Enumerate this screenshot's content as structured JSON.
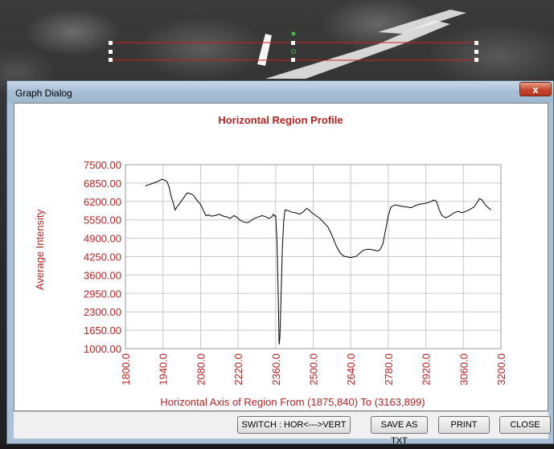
{
  "dialog": {
    "title": "Graph Dialog",
    "close_glyph": "x",
    "buttons": {
      "switch": "SWITCH : HOR<--->VERT",
      "save": "SAVE AS TXT",
      "print": "PRINT",
      "close": "CLOSE"
    }
  },
  "colors": {
    "axis_text": "#b22222",
    "title": "#b22222",
    "series": "#000000",
    "grid": "#c8c8c8",
    "roi_line": "#cc2020",
    "handle": "#ffffff",
    "anchor": "#40c040"
  },
  "chart_data": {
    "type": "line",
    "title": "Horizontal Region Profile",
    "xlabel": "Horizontal Axis of Region From (1875,840) To (3163,899)",
    "ylabel": "Average Intensity",
    "xlim": [
      1800,
      3200
    ],
    "ylim": [
      1000,
      7500
    ],
    "grid": true,
    "x_ticks": [
      "1800.0",
      "1940.0",
      "2080.0",
      "2220.0",
      "2360.0",
      "2500.0",
      "2640.0",
      "2780.0",
      "2920.0",
      "3060.0",
      "3200.0"
    ],
    "y_ticks": [
      "7500.00",
      "6850.00",
      "6200.00",
      "5550.00",
      "4900.00",
      "4250.00",
      "3600.00",
      "2950.00",
      "2300.00",
      "1650.00",
      "1000.00"
    ],
    "series": [
      {
        "x": [
          1875,
          1890,
          1905,
          1920,
          1935,
          1945,
          1955,
          1963,
          1970,
          1978,
          1985,
          1992,
          2000,
          2015,
          2030,
          2040,
          2048,
          2055,
          2062,
          2070,
          2080,
          2090,
          2100,
          2110,
          2120,
          2135,
          2150,
          2165,
          2180,
          2190,
          2205,
          2218,
          2225,
          2240,
          2255,
          2265,
          2280,
          2295,
          2310,
          2325,
          2335,
          2345,
          2352,
          2356,
          2360,
          2365,
          2370,
          2373,
          2376,
          2380,
          2385,
          2390,
          2395,
          2405,
          2420,
          2435,
          2450,
          2465,
          2475,
          2485,
          2495,
          2510,
          2525,
          2540,
          2555,
          2570,
          2585,
          2600,
          2615,
          2625,
          2635,
          2645,
          2660,
          2675,
          2685,
          2695,
          2710,
          2725,
          2740,
          2750,
          2760,
          2770,
          2780,
          2790,
          2805,
          2820,
          2835,
          2850,
          2865,
          2880,
          2895,
          2910,
          2925,
          2940,
          2950,
          2960,
          2970,
          2980,
          2995,
          3010,
          3025,
          3040,
          3055,
          3070,
          3080,
          3090,
          3100,
          3110,
          3120,
          3130,
          3140,
          3150,
          3163
        ],
        "values": [
          6750,
          6800,
          6850,
          6900,
          6980,
          6960,
          6900,
          6700,
          6400,
          6150,
          5900,
          6000,
          6100,
          6300,
          6500,
          6480,
          6450,
          6400,
          6300,
          6200,
          6100,
          5900,
          5700,
          5720,
          5680,
          5700,
          5750,
          5680,
          5650,
          5600,
          5700,
          5620,
          5550,
          5480,
          5450,
          5500,
          5600,
          5650,
          5700,
          5650,
          5600,
          5650,
          5750,
          5680,
          5700,
          4800,
          2800,
          1150,
          1400,
          2800,
          4500,
          5500,
          5900,
          5880,
          5820,
          5800,
          5750,
          5850,
          5950,
          5900,
          5800,
          5700,
          5600,
          5450,
          5300,
          5000,
          4650,
          4380,
          4260,
          4250,
          4220,
          4230,
          4260,
          4380,
          4460,
          4500,
          4510,
          4480,
          4450,
          4500,
          4700,
          5200,
          5700,
          6000,
          6080,
          6050,
          6020,
          6000,
          5980,
          6050,
          6100,
          6120,
          6150,
          6200,
          6250,
          6200,
          5900,
          5700,
          5620,
          5700,
          5800,
          5850,
          5800,
          5850,
          5900,
          5950,
          6000,
          6150,
          6300,
          6250,
          6100,
          6000,
          5900
        ]
      }
    ]
  }
}
